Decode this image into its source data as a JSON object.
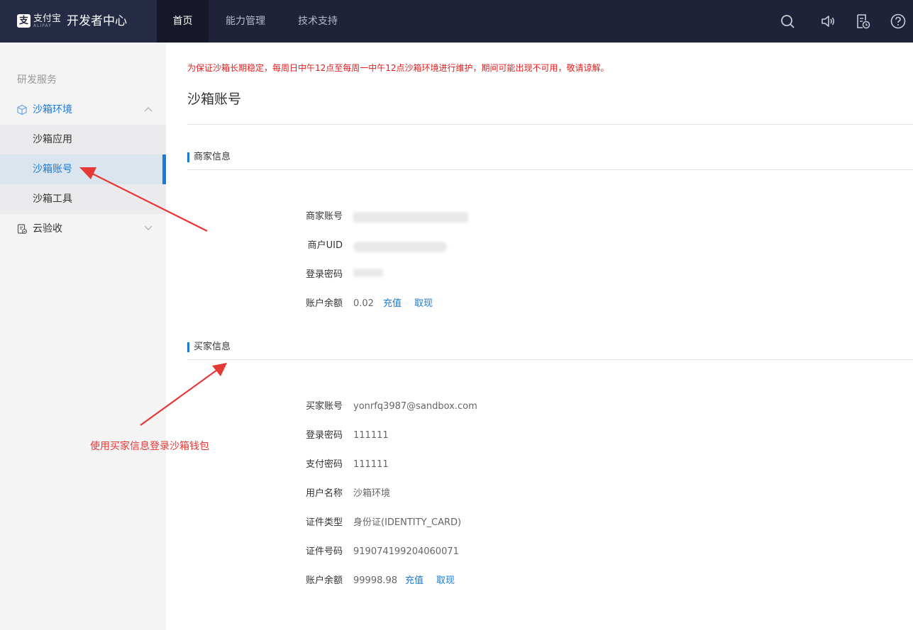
{
  "header": {
    "logo_text": "支付宝",
    "logo_sub": "ALIPAY",
    "title": "开发者中心",
    "nav": [
      {
        "label": "首页",
        "active": true
      },
      {
        "label": "能力管理",
        "active": false
      },
      {
        "label": "技术支持",
        "active": false
      }
    ],
    "icons": [
      "search-icon",
      "speaker-icon",
      "document-clock-icon",
      "help-icon"
    ]
  },
  "sidebar": {
    "group_label": "研发服务",
    "sandbox": {
      "label": "沙箱环境",
      "expanded": true,
      "items": [
        {
          "label": "沙箱应用",
          "active": false
        },
        {
          "label": "沙箱账号",
          "active": true
        },
        {
          "label": "沙箱工具",
          "active": false
        }
      ]
    },
    "cloud_acceptance": {
      "label": "云验收",
      "expanded": false
    }
  },
  "main": {
    "notice": "为保证沙箱长期稳定，每周日中午12点至每周一中午12点沙箱环境进行维护，期间可能出现不可用，敬请谅解。",
    "title": "沙箱账号",
    "merchant": {
      "heading": "商家信息",
      "account_label": "商家账号",
      "uid_label": "商户UID",
      "password_label": "登录密码",
      "balance_label": "账户余额",
      "balance": "0.02",
      "recharge": "充值",
      "withdraw": "取现"
    },
    "buyer": {
      "heading": "买家信息",
      "account_label": "买家账号",
      "account": "yonrfq3987@sandbox.com",
      "login_password_label": "登录密码",
      "login_password": "111111",
      "pay_password_label": "支付密码",
      "pay_password": "111111",
      "username_label": "用户名称",
      "username": "沙箱环境",
      "id_type_label": "证件类型",
      "id_type": "身份证(IDENTITY_CARD)",
      "id_number_label": "证件号码",
      "id_number": "919074199204060071",
      "balance_label": "账户余额",
      "balance": "99998.98",
      "recharge": "充值",
      "withdraw": "取现"
    }
  },
  "annotation": {
    "text": "使用买家信息登录沙箱钱包",
    "color": "#e53935"
  },
  "colors": {
    "accent": "#1a7ad9",
    "topbar": "#1f2238",
    "notice": "#e02020"
  }
}
